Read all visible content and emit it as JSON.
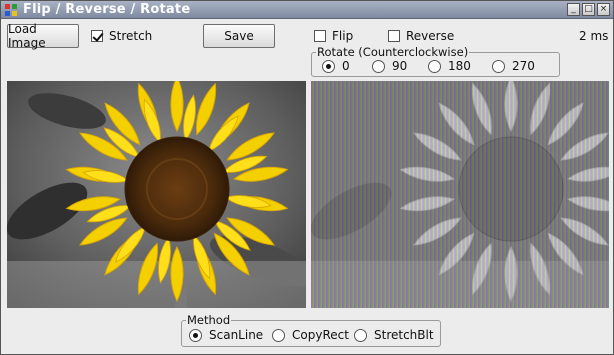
{
  "window": {
    "title": "Flip / Reverse / Rotate",
    "controls": {
      "minimize": "_",
      "maximize": "□",
      "close": "×"
    }
  },
  "toolbar": {
    "load_label": "Load Image",
    "stretch_label": "Stretch",
    "stretch_checked": true,
    "save_label": "Save",
    "flip_label": "Flip",
    "flip_checked": false,
    "reverse_label": "Reverse",
    "reverse_checked": false,
    "timing": "2 ms"
  },
  "rotate": {
    "title": "Rotate (Counterclockwise)",
    "options": [
      "0",
      "90",
      "180",
      "270"
    ],
    "selected": "0"
  },
  "method": {
    "title": "Method",
    "options": [
      "ScanLine",
      "CopyRect",
      "StretchBlt"
    ],
    "selected": "ScanLine"
  },
  "images": {
    "source": "sunflower photo (color flower, grayscale background)",
    "result": "processed sunflower with vertical color stripes"
  }
}
